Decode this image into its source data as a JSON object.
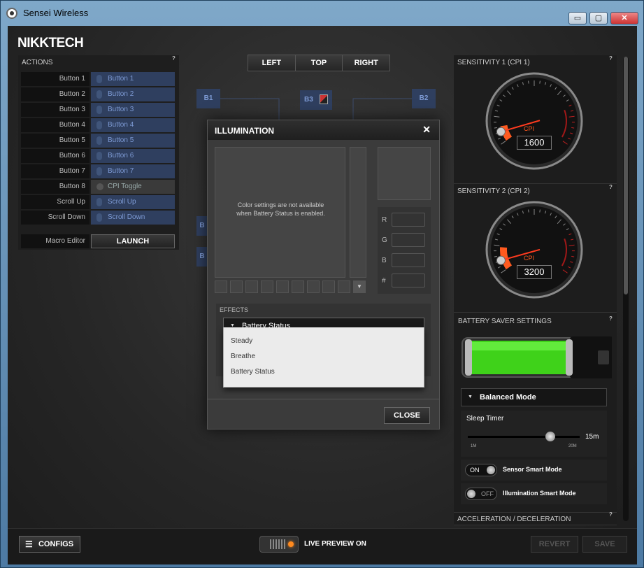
{
  "window": {
    "title": "Sensei Wireless",
    "min_label": "▭",
    "max_label": "▢",
    "close_label": "✕"
  },
  "brand": "NIKKTECH",
  "actions": {
    "title": "ACTIONS",
    "help": "?",
    "rows": [
      {
        "label": "Button 1",
        "value": "Button 1"
      },
      {
        "label": "Button 2",
        "value": "Button 2"
      },
      {
        "label": "Button 3",
        "value": "Button 3"
      },
      {
        "label": "Button 4",
        "value": "Button 4"
      },
      {
        "label": "Button 5",
        "value": "Button 5"
      },
      {
        "label": "Button 6",
        "value": "Button 6"
      },
      {
        "label": "Button 7",
        "value": "Button 7"
      },
      {
        "label": "Button 8",
        "value": "CPI Toggle"
      },
      {
        "label": "Scroll Up",
        "value": "Scroll Up"
      },
      {
        "label": "Scroll Down",
        "value": "Scroll Down"
      }
    ],
    "macro_label": "Macro Editor",
    "launch_label": "LAUNCH"
  },
  "view": {
    "left": "LEFT",
    "top": "TOP",
    "right": "RIGHT"
  },
  "nodes": {
    "b1": "B1",
    "b2": "B2",
    "b3": "B3",
    "partial": "B"
  },
  "illumination": {
    "title": "ILLUMINATION",
    "close_x": "✕",
    "notice": "Color settings are not available when Battery Status is enabled.",
    "r": "R",
    "g": "G",
    "b": "B",
    "hex": "#",
    "effects_label": "EFFECTS",
    "effect_selected": "Battery Status",
    "options": [
      "Steady",
      "Breathe",
      "Battery Status"
    ],
    "close_button": "CLOSE"
  },
  "sensitivity1": {
    "title": "SENSITIVITY 1 (CPI 1)",
    "help": "?",
    "cpi_label": "CPI",
    "value": "1600",
    "level": 0.3
  },
  "sensitivity2": {
    "title": "SENSITIVITY 2 (CPI 2)",
    "help": "?",
    "cpi_label": "CPI",
    "value": "3200",
    "level": 0.45
  },
  "battery": {
    "title": "BATTERY SAVER SETTINGS",
    "help": "?",
    "mode": "Balanced Mode",
    "sleep_label": "Sleep Timer",
    "sleep_value": "15m",
    "min_label": "1M",
    "max_label": "20M",
    "sensor_toggle": "ON",
    "sensor_label": "Sensor Smart Mode",
    "illum_toggle": "OFF",
    "illum_label": "Illumination Smart Mode"
  },
  "accel": {
    "title": "ACCELERATION / DECELERATION",
    "help": "?"
  },
  "bottom": {
    "configs": "CONFIGS",
    "live_preview": "LIVE PREVIEW ON",
    "revert": "REVERT",
    "save": "SAVE"
  },
  "colors": {
    "accent": "#ff5a1f",
    "battery_green": "#3fd21a",
    "node_blue": "#2f3f5f"
  }
}
